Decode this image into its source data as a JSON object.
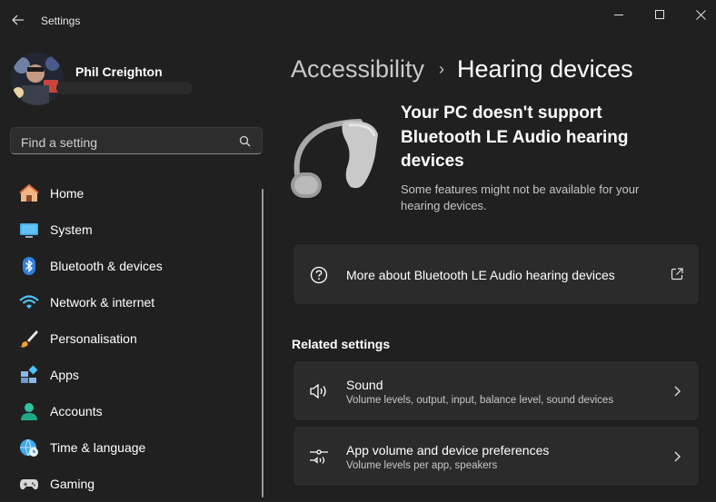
{
  "window": {
    "title": "Settings",
    "back_icon": "arrow-left-icon",
    "controls": [
      "minimize-icon",
      "maximize-icon",
      "close-icon"
    ]
  },
  "profile": {
    "name": "Phil Creighton"
  },
  "search": {
    "placeholder": "Find a setting",
    "icon": "search-icon"
  },
  "sidebar": {
    "items": [
      {
        "label": "Home",
        "icon": "home-icon"
      },
      {
        "label": "System",
        "icon": "monitor-icon"
      },
      {
        "label": "Bluetooth & devices",
        "icon": "bluetooth-icon"
      },
      {
        "label": "Network & internet",
        "icon": "wifi-icon"
      },
      {
        "label": "Personalisation",
        "icon": "brush-icon"
      },
      {
        "label": "Apps",
        "icon": "apps-icon"
      },
      {
        "label": "Accounts",
        "icon": "person-icon"
      },
      {
        "label": "Time & language",
        "icon": "globe-clock-icon"
      },
      {
        "label": "Gaming",
        "icon": "gamepad-icon"
      }
    ]
  },
  "breadcrumb": {
    "parent": "Accessibility",
    "separator": "›",
    "current": "Hearing devices"
  },
  "hero": {
    "title": "Your PC doesn't support Bluetooth LE Audio hearing devices",
    "subtitle": "Some features might not be available for your hearing devices.",
    "image": "hearing-aid-image"
  },
  "more_link": {
    "label": "More about Bluetooth LE Audio hearing devices",
    "icon": "help-circle-icon",
    "end_icon": "open-external-icon"
  },
  "related": {
    "heading": "Related settings",
    "items": [
      {
        "title": "Sound",
        "desc": "Volume levels, output, input, balance level, sound devices",
        "icon": "speaker-icon",
        "end_icon": "chevron-right-icon"
      },
      {
        "title": "App volume and device preferences",
        "desc": "Volume levels per app, speakers",
        "icon": "volume-mixer-icon",
        "end_icon": "chevron-right-icon"
      }
    ]
  },
  "colors": {
    "background": "#202020",
    "card": "#2b2b2b",
    "accent": "#4cc2ff"
  }
}
